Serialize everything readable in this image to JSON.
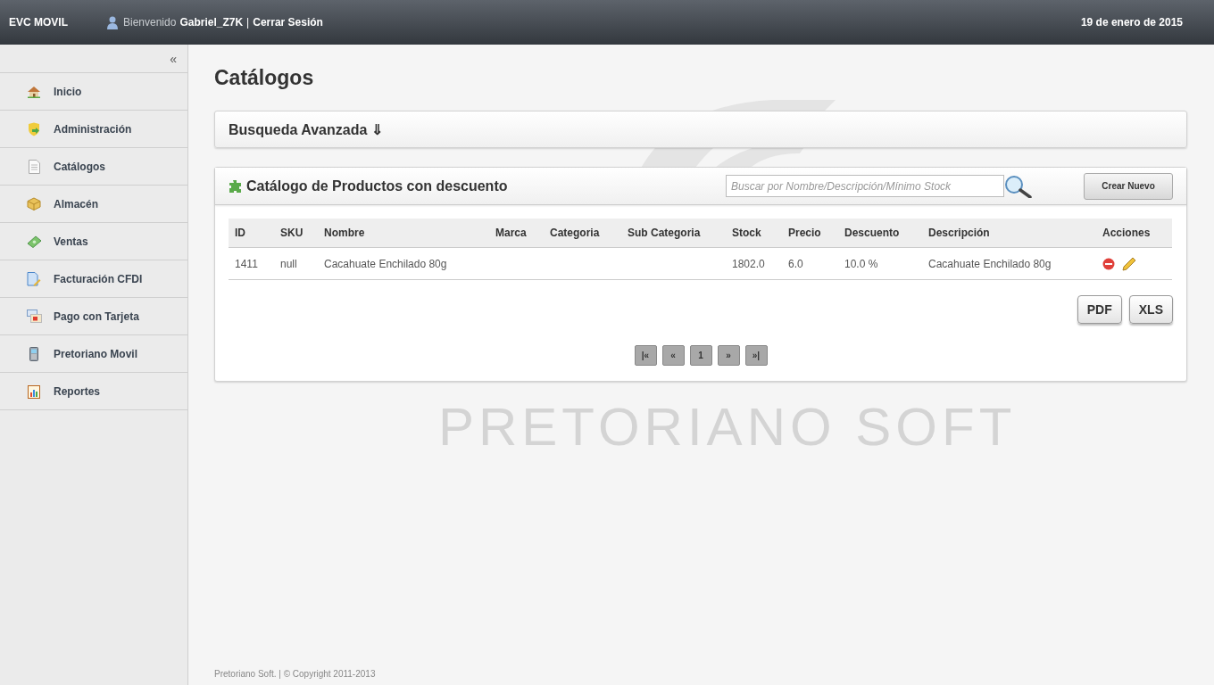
{
  "header": {
    "app_name": "EVC MOVIL",
    "welcome": "Bienvenido",
    "user_name": "Gabriel_Z7K",
    "separator": "|",
    "logout": "Cerrar Sesión",
    "date": "19 de enero de 2015"
  },
  "sidebar": {
    "collapse": "«",
    "items": [
      {
        "label": "Inicio"
      },
      {
        "label": "Administración"
      },
      {
        "label": "Catálogos"
      },
      {
        "label": "Almacén"
      },
      {
        "label": "Ventas"
      },
      {
        "label": "Facturación CFDI"
      },
      {
        "label": "Pago con Tarjeta"
      },
      {
        "label": "Pretoriano Movil"
      },
      {
        "label": "Reportes"
      }
    ]
  },
  "page_title": "Catálogos",
  "advanced_search": {
    "title": "Busqueda Avanzada ⇓"
  },
  "catalog": {
    "title": "Catálogo de Productos con descuento",
    "search": {
      "placeholder": "Buscar por Nombre/Descripción/Mínimo Stock"
    },
    "create_button": "Crear Nuevo",
    "table": {
      "columns": [
        "ID",
        "SKU",
        "Nombre",
        "Marca",
        "Categoria",
        "Sub Categoria",
        "Stock",
        "Precio",
        "Descuento",
        "Descripción",
        "Acciones"
      ],
      "rows": [
        {
          "cells": [
            "1411",
            "null",
            "Cacahuate Enchilado 80g",
            "",
            "",
            "",
            "1802.0",
            "6.0",
            "10.0 %",
            "Cacahuate Enchilado 80g"
          ]
        }
      ]
    },
    "export_buttons": [
      "PDF",
      "XLS"
    ],
    "pager": [
      "|«",
      "«",
      "1",
      "»",
      "»|"
    ]
  },
  "background_logo": "PRETORIANO SOFT",
  "footer": "Pretoriano Soft. | © Copyright 2011-2013"
}
